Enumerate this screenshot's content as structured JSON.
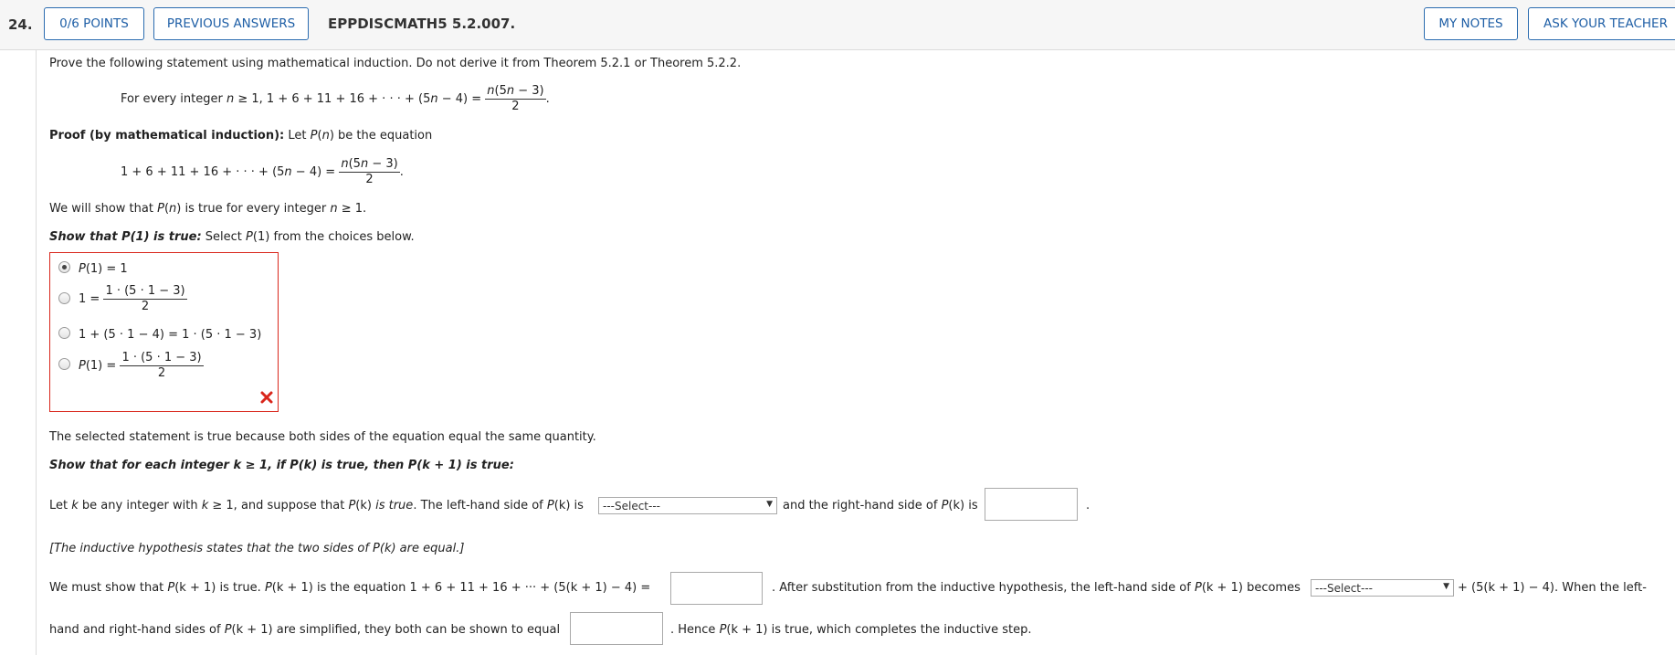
{
  "header": {
    "number": "24.",
    "points": "0/6 POINTS",
    "previous": "PREVIOUS ANSWERS",
    "code": "EPPDISCMATH5 5.2.007.",
    "notes": "MY NOTES",
    "ask": "ASK YOUR TEACHER"
  },
  "question": {
    "intro": "Prove the following statement using mathematical induction. Do not derive it from Theorem 5.2.1 or Theorem 5.2.2.",
    "stmt_prefix": "For every integer ",
    "stmt_cond": " ≥ 1, 1 + 6 + 11 + 16 + · · · + (5",
    "stmt_mid": " − 4) = ",
    "frac_num": "(5",
    "frac_num_end": " − 3)",
    "frac_den": "2",
    "period": ".",
    "var_n": "n"
  },
  "proof": {
    "label": "Proof (by mathematical induction):",
    "let_text": " Let ",
    "P": "P",
    "be_eq": " be the equation",
    "eq_lhs": "1 + 6 + 11 + 16 + · · · + (5",
    "eq_mid": " − 4) = ",
    "show_all_pre": "We will show that ",
    "show_all_mid": " is true for every integer ",
    "show_all_end": " ≥ 1."
  },
  "base": {
    "label": "Show that P(1) is true:",
    "instr_pre": " Select ",
    "instr_post": " from the choices below.",
    "P1": "P",
    "one_paren": "(1)",
    "choice1_rest": " = 1",
    "choice2_lhs": "1 = ",
    "choice2_num": "1 · (5 · 1 − 3)",
    "choice2_den": "2",
    "choice3": "1 + (5 · 1 − 4) = 1 · (5 · 1 − 3)",
    "choice4_eq": " = ",
    "choice4_num": "1 · (5 · 1 − 3)",
    "choice4_den": "2",
    "selected_index": 0,
    "explanation": "The selected statement is true because both sides of the equation equal the same quantity."
  },
  "inductive": {
    "label": "Show that for each integer k ≥ 1, if P(k) is true, then P(k + 1) is true:",
    "let_pre": "Let ",
    "k": "k",
    "let_mid": " be any integer with ",
    "let_mid2": " ≥ 1, and suppose that ",
    "Pk": "P",
    "k_paren": "(k)",
    "is_true": " is true",
    "lhs_pre": ". The left-hand side of ",
    "lhs_is": " is ",
    "select_placeholder": "---Select---",
    "rhs_pre": " and the right-hand side of ",
    "dot": ".",
    "hypothesis": "[The inductive hypothesis states that the two sides of ",
    "hypothesis_end": " are equal.]",
    "must_pre": "We must show that ",
    "kp1_paren": "(k + 1)",
    "must_mid": " is true. ",
    "is_eq": " is the equation 1 + 6 + 11 + 16 + ··· + (5(k + 1) − 4) = ",
    "after_sub": ". After substitution from the inductive hypothesis, the left-hand side of ",
    "becomes": " becomes ",
    "plus_term": " + (5(k + 1) − 4). When the left-",
    "hand_pre": "hand and right-hand sides of ",
    "hand_mid": " are simplified, they both can be shown to equal ",
    "hence": ". Hence ",
    "completes": " is true, which completes the inductive step."
  },
  "colors": {
    "accent": "#1f5fa6",
    "error": "#d9261c"
  }
}
